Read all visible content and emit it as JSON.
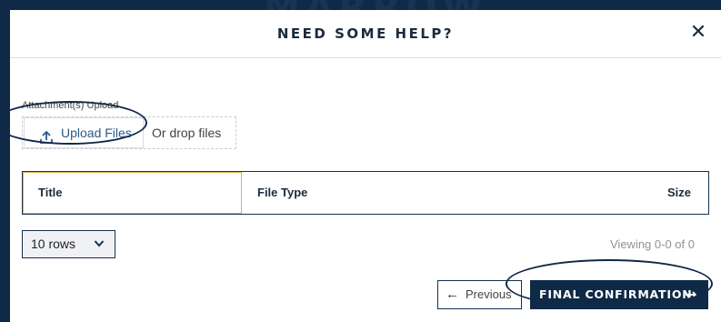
{
  "background": {
    "text": "MARROW"
  },
  "modal": {
    "title": "NEED SOME HELP?",
    "close_glyph": "✕"
  },
  "upload": {
    "label": "Attachment(s) Upload",
    "button_label": "Upload Files",
    "button_icon": "upload-icon",
    "drop_text": "Or drop files"
  },
  "table": {
    "columns": [
      "Title",
      "File Type",
      "Size"
    ]
  },
  "pagination": {
    "rows_option": "10 rows",
    "viewing_text": "Viewing 0-0 of 0",
    "previous_label": "Previous",
    "final_label": "FINAL CONFIRMATION"
  },
  "colors": {
    "navy": "#0f2a47",
    "highlight_border": "#d9b54a",
    "link_blue": "#2b5a8a"
  }
}
